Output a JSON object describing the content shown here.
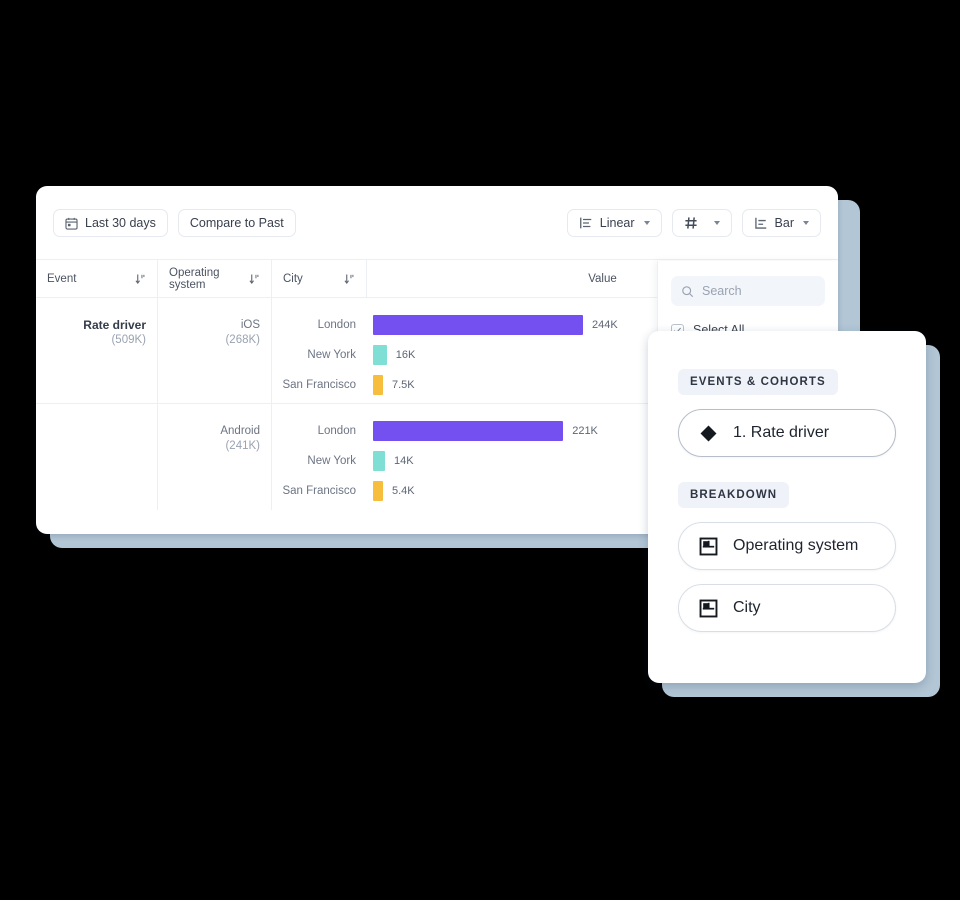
{
  "toolbar": {
    "date_range": {
      "label": "Last 30 days",
      "icon": "calendar-icon"
    },
    "compare": {
      "label": "Compare to Past"
    },
    "scale": {
      "label": "Linear",
      "icon": "axis-scale-icon"
    },
    "grid": {
      "label": "",
      "icon": "grid-icon"
    },
    "chart_type": {
      "label": "Bar",
      "icon": "bar-chart-icon"
    }
  },
  "table": {
    "headers": {
      "event": "Event",
      "operating_system": "Operating system",
      "city": "City",
      "value": "Value"
    },
    "groups": [
      {
        "event": "Rate driver",
        "event_total": "(509K)",
        "os": "iOS",
        "os_total": "(268K)",
        "rows": [
          {
            "city": "London",
            "value_label": "244K",
            "value": 244000,
            "color": "#7550f0"
          },
          {
            "city": "New York",
            "value_label": "16K",
            "value": 16000,
            "color": "#7fdfd4"
          },
          {
            "city": "San Francisco",
            "value_label": "7.5K",
            "value": 7500,
            "color": "#f7be3e"
          }
        ]
      },
      {
        "event": "",
        "event_total": "",
        "os": "Android",
        "os_total": "(241K)",
        "rows": [
          {
            "city": "London",
            "value_label": "221K",
            "value": 221000,
            "color": "#7550f0"
          },
          {
            "city": "New York",
            "value_label": "14K",
            "value": 14000,
            "color": "#7fdfd4"
          },
          {
            "city": "San Francisco",
            "value_label": "5.4K",
            "value": 5400,
            "color": "#f7be3e"
          }
        ]
      }
    ]
  },
  "search_panel": {
    "placeholder": "Search",
    "select_all_label": "Select All",
    "select_all_checked": true
  },
  "front_panel": {
    "events_section_title": "EVENTS & COHORTS",
    "event_item": {
      "label": "1. Rate driver",
      "icon": "diamond-icon"
    },
    "breakdown_section_title": "BREAKDOWN",
    "breakdown_items": [
      {
        "label": "Operating system",
        "icon": "property-icon"
      },
      {
        "label": "City",
        "icon": "property-icon"
      }
    ]
  },
  "chart_data": {
    "type": "bar",
    "title": "",
    "xlabel": "Value",
    "ylabel": "City",
    "orientation": "horizontal",
    "grid": false,
    "legend": "none",
    "series": [
      {
        "name": "Rate driver / iOS",
        "group_total": 268000,
        "categories": [
          "London",
          "New York",
          "San Francisco"
        ],
        "values": [
          244000,
          16000,
          7500
        ],
        "value_labels": [
          "244K",
          "16K",
          "7.5K"
        ],
        "colors": [
          "#7550f0",
          "#7fdfd4",
          "#f7be3e"
        ]
      },
      {
        "name": "Rate driver / Android",
        "group_total": 241000,
        "categories": [
          "London",
          "New York",
          "San Francisco"
        ],
        "values": [
          221000,
          14000,
          5400
        ],
        "value_labels": [
          "221K",
          "14K",
          "5.4K"
        ],
        "colors": [
          "#7550f0",
          "#7fdfd4",
          "#f7be3e"
        ]
      }
    ],
    "xlim": [
      0,
      244000
    ],
    "event_total": 509000
  }
}
